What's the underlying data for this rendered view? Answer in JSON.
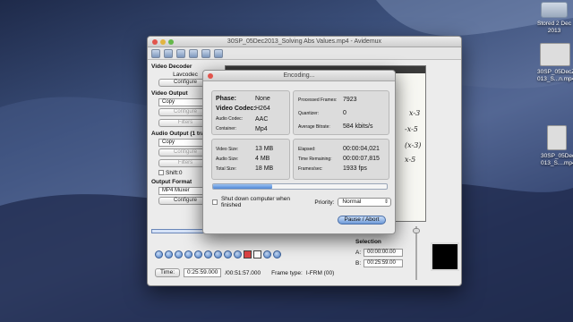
{
  "desktop": {
    "icons": [
      {
        "label": "Stored 2 Dec 2013"
      },
      {
        "label": "30SP_05DecZ 013_S...n.mp4"
      },
      {
        "label": "30SP_05DecZ 013_S....mp4"
      }
    ]
  },
  "main_window": {
    "title": "30SP_05Dec2013_Solving Abs Values.mp4 - Avidemux",
    "video_decoder": {
      "title": "Video Decoder",
      "codec": "Lavcodec",
      "configure": "Configure"
    },
    "video_output": {
      "title": "Video Output",
      "value": "Copy",
      "configure": "Configure",
      "filters": "Filters"
    },
    "audio_output": {
      "title": "Audio Output (1 tra",
      "value": "Copy",
      "configure": "Configure",
      "filters": "Filters",
      "shift_label": "Shift:",
      "shift_value": "0"
    },
    "output_format": {
      "title": "Output Format",
      "value": "MP4 Muxer",
      "configure": "Configure"
    },
    "transport": {
      "time_button": "Time:",
      "current_time": "0:25:59.000",
      "total_time": "/00:51:57.000",
      "frame_type_label": "Frame type:",
      "frame_type_value": "I-FRM (00)"
    },
    "selection": {
      "title": "Selection",
      "a_label": "A:",
      "a_value": "00:00:00.00",
      "b_label": "B:",
      "b_value": "00:25:59.00"
    },
    "handwriting": [
      "x-3",
      "-x-5",
      "(x-3)",
      "x-5"
    ]
  },
  "encoding_dialog": {
    "title": "Encoding...",
    "phase_label": "Phase:",
    "phase_value": "None",
    "video_codec_label": "Video Codec:",
    "video_codec_value": "H264",
    "audio_codec_label": "Audio Codec:",
    "audio_codec_value": "AAC",
    "container_label": "Container:",
    "container_value": "Mp4",
    "processed_frames_label": "Processed Frames:",
    "processed_frames_value": "7923",
    "quantizer_label": "Quantizer:",
    "quantizer_value": "0",
    "avg_bitrate_label": "Average Bitrate:",
    "avg_bitrate_value": "584 kbits/s",
    "video_size_label": "Video Size:",
    "video_size_value": "13 MB",
    "audio_size_label": "Audio Size:",
    "audio_size_value": "4 MB",
    "total_size_label": "Total Size:",
    "total_size_value": "18 MB",
    "elapsed_label": "Elapsed:",
    "elapsed_value": "00:00:04,021",
    "remaining_label": "Time Remaining:",
    "remaining_value": "00:00:07,815",
    "fps_label": "Frames/sec:",
    "fps_value": "1933 fps",
    "progress_fraction": 0.34,
    "shutdown_label": "Shut down computer when finished",
    "priority_label": "Priority:",
    "priority_value": "Normal",
    "pause_abort": "Pause / Abort"
  }
}
